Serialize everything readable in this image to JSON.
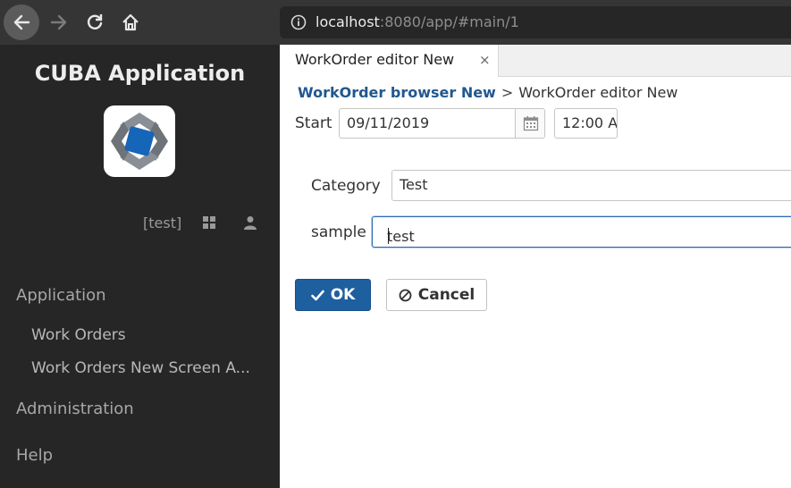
{
  "browser": {
    "url_host": "localhost",
    "url_rest": ":8080/app/#main/1"
  },
  "sidebar": {
    "app_title": "CUBA Application",
    "user": "[test]",
    "menu": [
      {
        "label": "Application"
      },
      {
        "label": "Work Orders"
      },
      {
        "label": "Work Orders New Screen A..."
      },
      {
        "label": "Administration"
      },
      {
        "label": "Help"
      }
    ]
  },
  "tab": {
    "label": "WorkOrder editor New",
    "close": "×"
  },
  "breadcrumb": {
    "link": "WorkOrder browser New",
    "separator": ">",
    "current": "WorkOrder editor New"
  },
  "form": {
    "start_label": "Start",
    "start_date": "09/11/2019",
    "start_time": "12:00 A",
    "category_label": "Category",
    "category_value": "Test",
    "sample_label": "sample",
    "sample_value": "test"
  },
  "buttons": {
    "ok": "OK",
    "cancel": "Cancel"
  },
  "colors": {
    "accent": "#1e5f9f",
    "link": "#21578f",
    "sidebar_bg": "#262626"
  }
}
